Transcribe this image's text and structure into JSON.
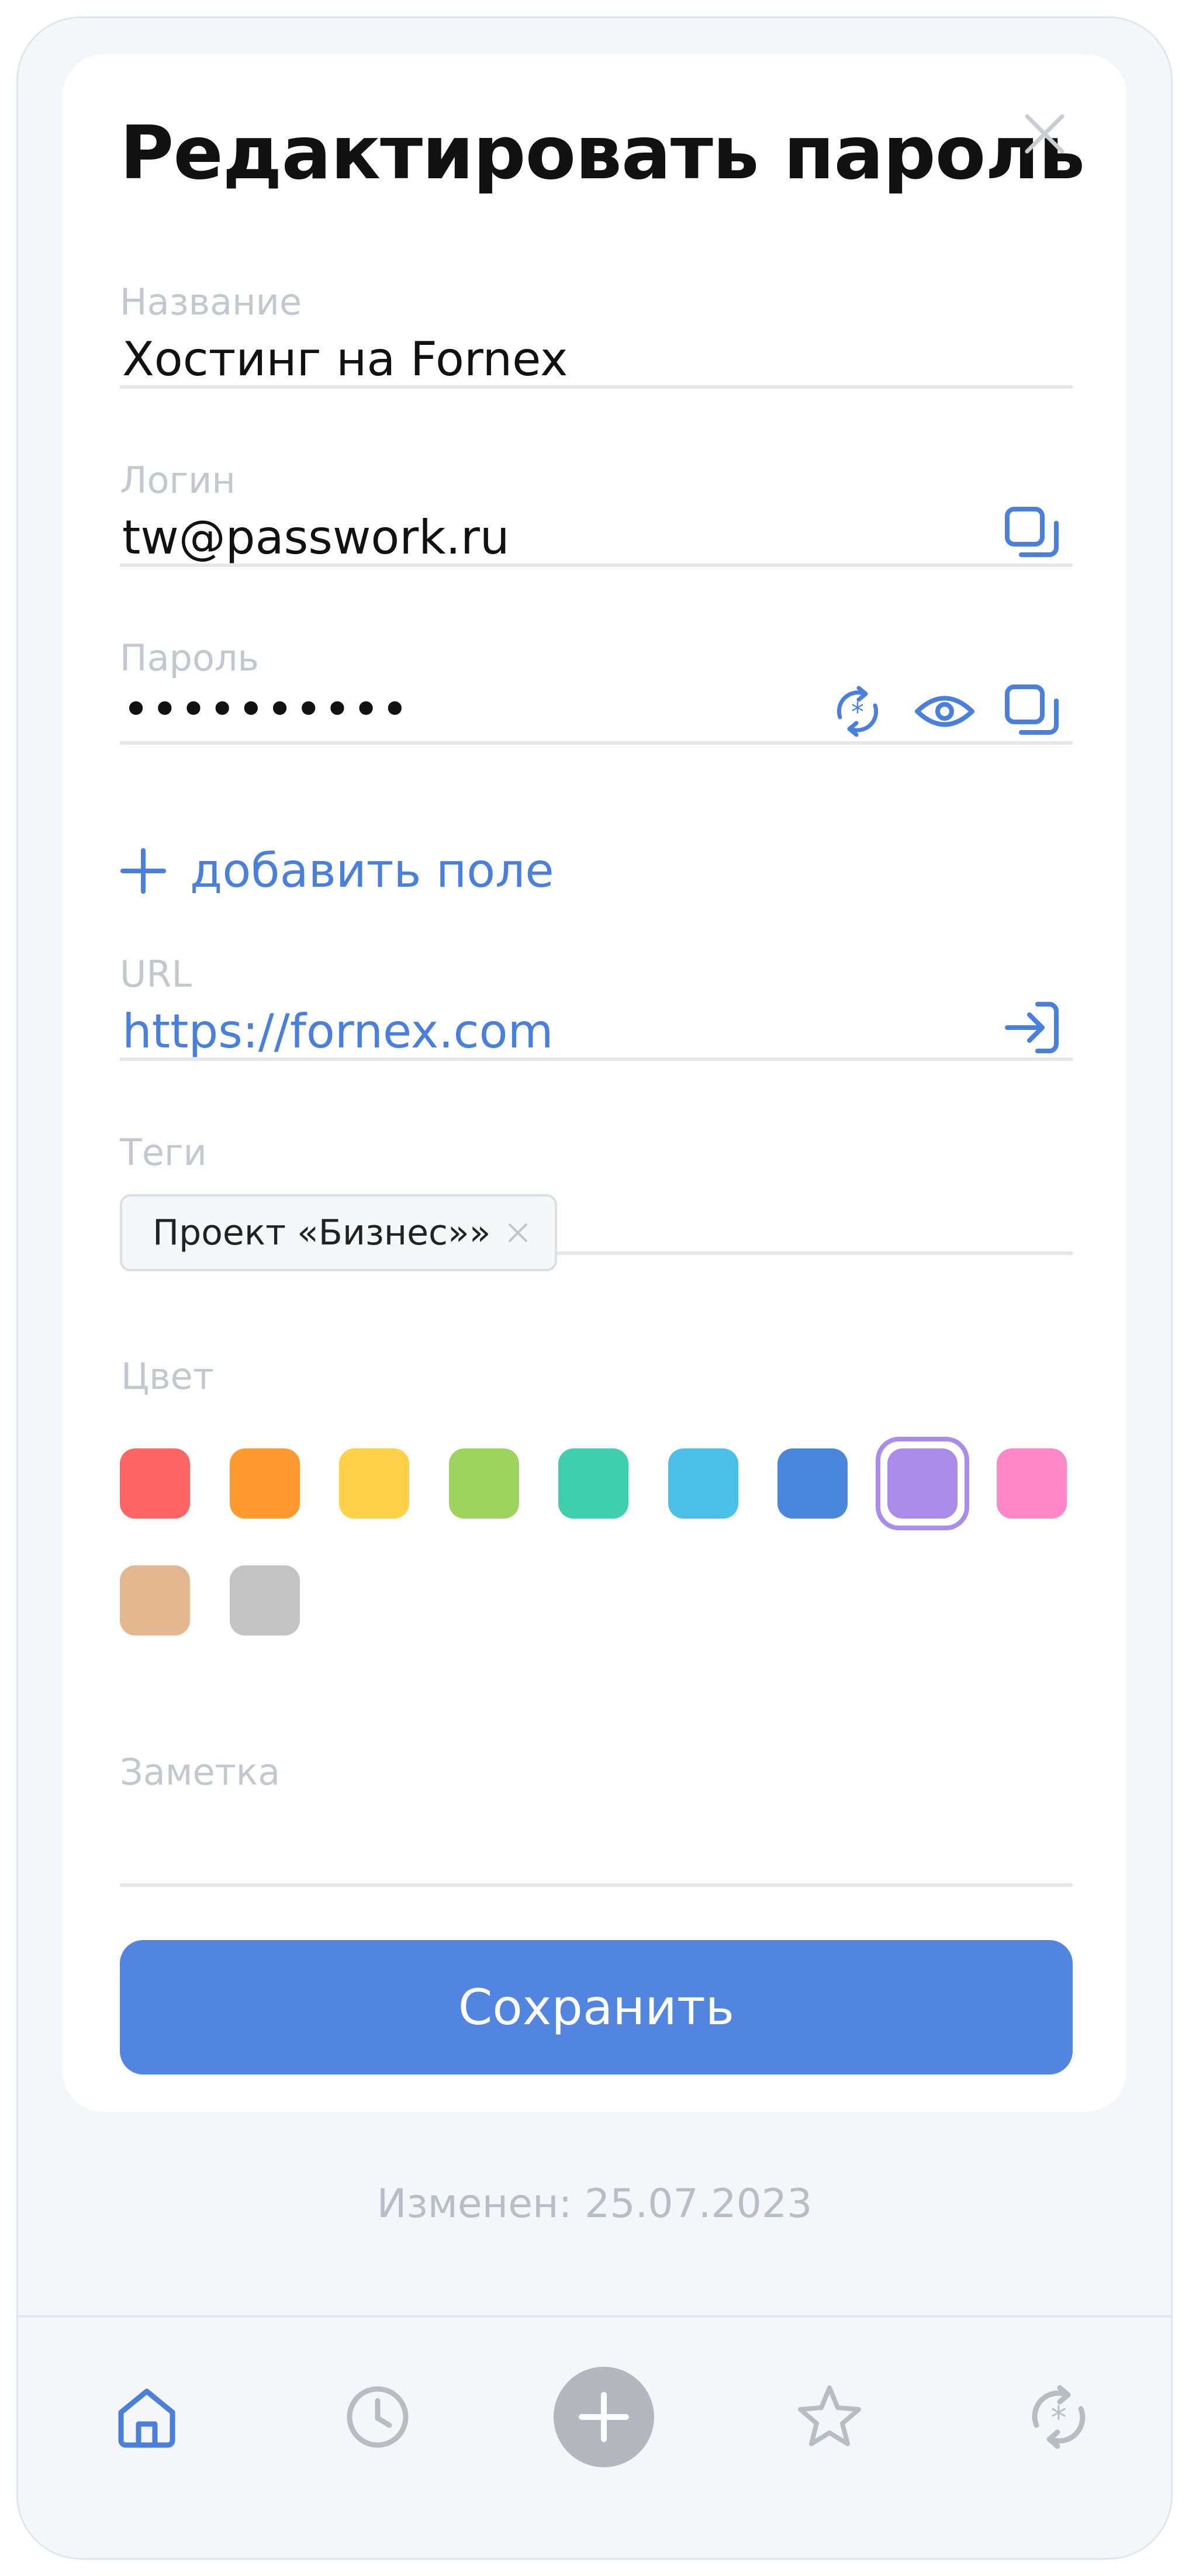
{
  "header": {
    "title": "Редактировать пароль"
  },
  "fields": {
    "name": {
      "label": "Название",
      "value": "Хостинг на Fornex"
    },
    "login": {
      "label": "Логин",
      "value": "tw@passwork.ru"
    },
    "password": {
      "label": "Пароль",
      "value": "••••••••••"
    },
    "url": {
      "label": "URL",
      "value": "https://fornex.com"
    },
    "tags": {
      "label": "Теги",
      "items": [
        "Проект «Бизнес»»"
      ]
    },
    "note": {
      "label": "Заметка",
      "value": ""
    }
  },
  "add_field": {
    "label": "добавить поле"
  },
  "color": {
    "label": "Цвет",
    "options": [
      "#ff6565",
      "#ff9a33",
      "#ffd04a",
      "#9fd35f",
      "#3fcfac",
      "#4bbfe8",
      "#4a86dc",
      "#aa8ce8",
      "#ff86c7",
      "#e3b891",
      "#c3c3c3"
    ],
    "selected": "#aa8ce8"
  },
  "save_button": {
    "label": "Сохранить"
  },
  "modified": "Изменен: 25.07.2023",
  "tabbar": {
    "items": [
      {
        "icon": "home-icon",
        "active": true
      },
      {
        "icon": "clock-icon",
        "active": false
      },
      {
        "icon": "plus-icon",
        "active": false
      },
      {
        "icon": "star-icon",
        "active": false
      },
      {
        "icon": "password-generator-icon",
        "active": false
      }
    ]
  },
  "colors": {
    "accent": "#4a7fdc",
    "button": "#5185e0",
    "muted": "#c3c8cf"
  }
}
